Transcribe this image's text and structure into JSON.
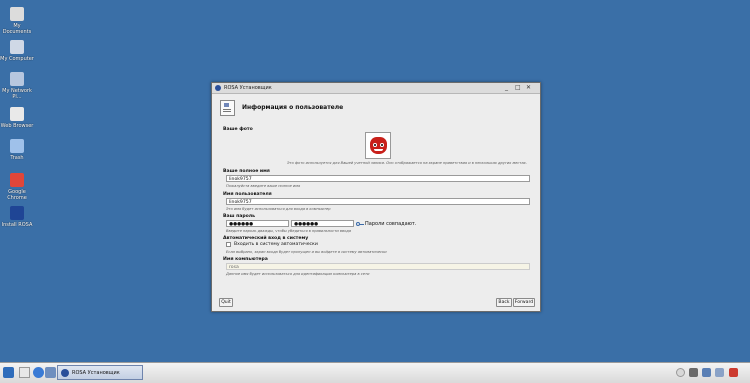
{
  "desktop": {
    "icons": [
      {
        "label": "My Documents",
        "color": "#dcdcdc"
      },
      {
        "label": "My Computer",
        "color": "#cfd8e6"
      },
      {
        "label": "My Network Pl...",
        "color": "#b7c7df"
      },
      {
        "label": "Web Browser",
        "color": "#e9e9e9"
      },
      {
        "label": "Trash",
        "color": "#9fc1ea"
      },
      {
        "label": "Google Chrome",
        "color": "#e0463a"
      },
      {
        "label": "Install ROSA",
        "color": "#1f4595"
      }
    ]
  },
  "window": {
    "title": "ROSA Установщик",
    "controls": {
      "minimize": "_",
      "maximize": "□",
      "close": "✕"
    },
    "heading": "Информация о пользователе",
    "photo": {
      "label": "Ваше фото",
      "hint": "Это фото используется для Вашей учетной записи. Оно отображается на экране приветствия и в нескольких других местах."
    },
    "full_name": {
      "label": "Ваше полное имя",
      "value": "linok9757",
      "hint": "Пожалуйста введите ваше полное имя"
    },
    "username": {
      "label": "Имя пользователя",
      "value": "linok9757",
      "hint": "Это имя будет использоваться для входа в компьютер"
    },
    "password": {
      "label": "Ваш пароль",
      "value": "●●●●●●",
      "confirm": "●●●●●●",
      "status": "Пароли совпадают.",
      "hint": "Введите пароль дважды, чтобы убедиться в правильности ввода"
    },
    "autologin": {
      "label": "Автоматический вход в систему",
      "checkbox_label": "Входить в систему автоматически",
      "hint": "Если выбрано, экран входа будет пропущен и вы войдете в систему автоматически"
    },
    "computer_name": {
      "label": "Имя компьютера",
      "value": "rosa",
      "hint": "Данное имя будет использоваться для идентификации компьютера в сети"
    },
    "buttons": {
      "quit": "Quit",
      "back": "Back",
      "forward": "Forward"
    }
  },
  "taskbar": {
    "task_label": "ROSA Установщик",
    "colors": {
      "start": "#2f6dbb",
      "accent": "#2a4f9a"
    }
  }
}
